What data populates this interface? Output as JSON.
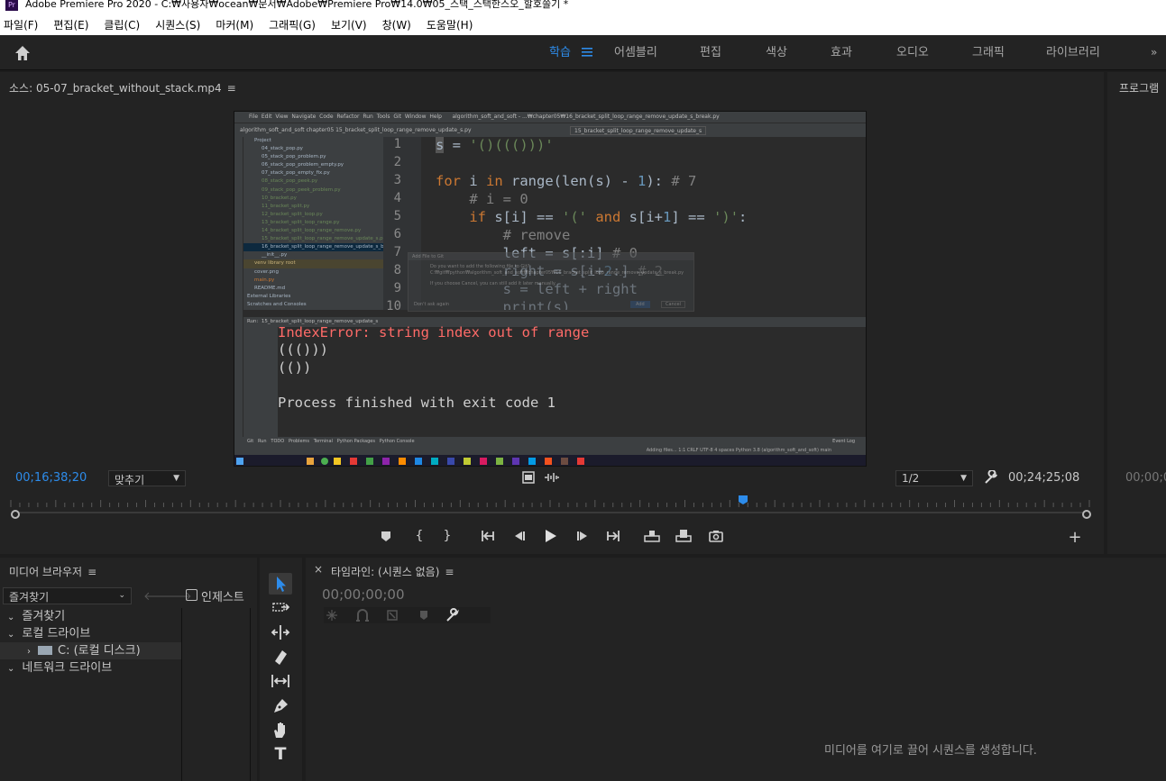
{
  "window": {
    "title": "Adobe Premiere Pro 2020 - C:₩사용자₩ocean₩문서₩Adobe₩Premiere Pro₩14.0₩05_스택_스택한스오_할호쫄기 *",
    "logo_text": "Pr"
  },
  "menubar": [
    "파일(F)",
    "편집(E)",
    "클립(C)",
    "시퀀스(S)",
    "마커(M)",
    "그래픽(G)",
    "보기(V)",
    "창(W)",
    "도움말(H)"
  ],
  "workspaces": {
    "active": "학습",
    "tabs": [
      "어셈블리",
      "편집",
      "색상",
      "효과",
      "오디오",
      "그래픽",
      "라이브러리"
    ]
  },
  "source_panel": {
    "title": "소스: 05-07_bracket_without_stack.mp4",
    "current_timecode": "00;16;38;20",
    "fit_dropdown": "맞추기",
    "resolution_dropdown": "1/2",
    "duration_timecode": "00;24;25;08",
    "playhead_fraction": 0.679
  },
  "program_panel": {
    "title": "프로그램",
    "timecode": "00;00;0"
  },
  "ide": {
    "menu": [
      "File",
      "Edit",
      "View",
      "Navigate",
      "Code",
      "Refactor",
      "Run",
      "Tools",
      "Git",
      "Window",
      "Help"
    ],
    "window_title": "algorithm_soft_and_soft - ...₩chapter05₩16_bracket_split_loop_range_remove_update_s_break.py",
    "breadcrumb": "algorithm_soft_and_soft  chapter05  15_bracket_split_loop_range_remove_update_s.py",
    "run_config": "15_bracket_split_loop_range_remove_update_s",
    "project_label": "Project",
    "files": [
      "04_stack_pop.py",
      "05_stack_pop_problem.py",
      "06_stack_pop_problem_empty.py",
      "07_stack_pop_empty_fix.py",
      "08_stack_pop_peek.py",
      "09_stack_pop_peek_problem.py",
      "10_bracket.py",
      "11_bracket_split.py",
      "12_bracket_split_loop.py",
      "13_bracket_split_loop_range.py",
      "14_bracket_split_loop_range_remove.py",
      "15_bracket_split_loop_range_remove_update_s.py",
      "16_bracket_split_loop_range_remove_update_s_break.py",
      "__init__.py",
      "venv  library root",
      "cover.png",
      "main.py",
      "README.md",
      "External Libraries",
      "Scratches and Consoles"
    ],
    "line_numbers": [
      "1",
      "2",
      "3",
      "4",
      "5",
      "6",
      "7",
      "8",
      "9",
      "10"
    ],
    "dialog": {
      "title": "Add File to Git",
      "message": "Do you want to add the following file to Git?",
      "path": "C:₩git₩python₩algorithm_soft_and_soft₩chapter05₩16_bracket_split_loop_range_remove_update_s_break.py",
      "note": "If you choose Cancel, you can still add it later manually.",
      "checkbox": "Don't ask again",
      "add_button": "Add",
      "cancel_button": "Cancel"
    },
    "run_tab_label": "Run:",
    "run_tab": "15_bracket_split_loop_range_remove_update_s",
    "console": {
      "error": "IndexError: string index out of range",
      "line1": "((()))",
      "line2": "(())",
      "finish": "Process finished with exit code 1"
    },
    "tool_tabs": [
      "Git",
      "Run",
      "TODO",
      "Problems",
      "Terminal",
      "Python Packages",
      "Python Console",
      "Event Log"
    ],
    "status": "Adding files...     1:1   CRLF   UTF-8   4 spaces   Python 3.8 (algorithm_soft_and_soft)   main"
  },
  "transport_icons": [
    "marker-icon",
    "mark-in-icon",
    "mark-out-icon",
    "go-to-in-icon",
    "step-back-icon",
    "play-icon",
    "step-forward-icon",
    "go-to-out-icon",
    "insert-icon",
    "overwrite-icon",
    "export-frame-icon",
    "add-button-icon"
  ],
  "media_browser": {
    "title": "미디어 브라우저",
    "location_dropdown": "즐겨찾기",
    "ingest_label": "인제스트",
    "tree": [
      {
        "label": "즐겨찾기",
        "level": 0,
        "expanded": true
      },
      {
        "label": "로컬 드라이브",
        "level": 0,
        "expanded": true
      },
      {
        "label": "C: (로컬 디스크)",
        "level": 1,
        "expanded": false
      },
      {
        "label": "네트워크 드라이브",
        "level": 0,
        "expanded": true
      }
    ]
  },
  "timeline": {
    "title": "타임라인: (시퀀스 없음)",
    "timecode": "00;00;00;00",
    "empty_message": "미디어를 여기로 끌어 시퀀스를 생성합니다."
  },
  "colors": {
    "accent_blue": "#2d8ceb",
    "panel_bg": "#232323",
    "app_bg": "#1d1d1d"
  }
}
